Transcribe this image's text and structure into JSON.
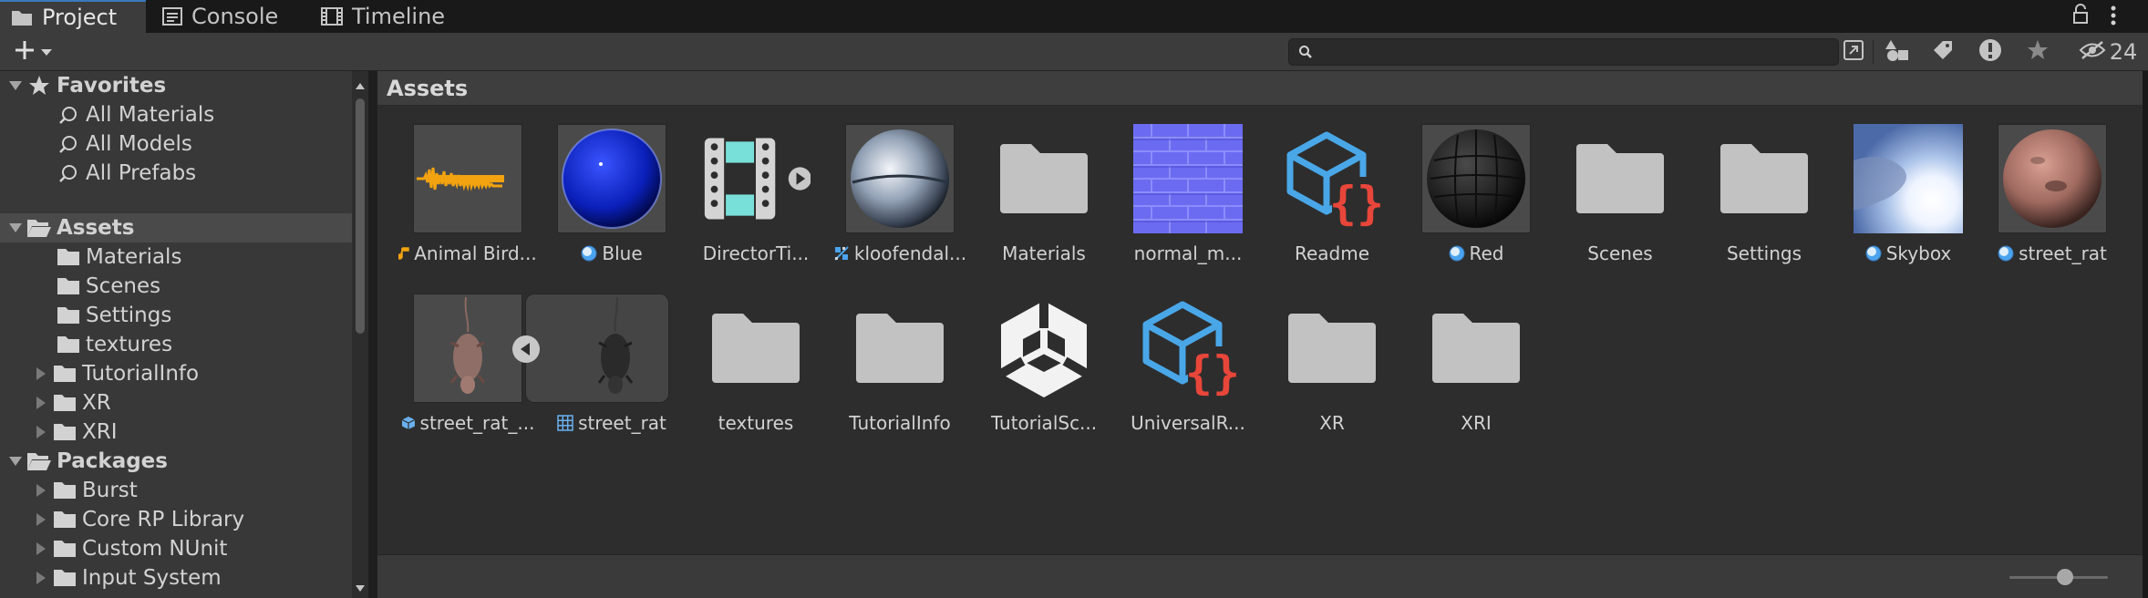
{
  "tabs": [
    {
      "label": "Project",
      "icon": "folder-icon",
      "active": true
    },
    {
      "label": "Console",
      "icon": "console-icon",
      "active": false
    },
    {
      "label": "Timeline",
      "icon": "film-icon",
      "active": false
    }
  ],
  "toolbar": {
    "create_icon": "plus-icon",
    "search_placeholder": "",
    "hidden_packages_count": "24"
  },
  "tree": {
    "favorites": {
      "label": "Favorites",
      "items": [
        "All Materials",
        "All Models",
        "All Prefabs"
      ]
    },
    "assets": {
      "label": "Assets",
      "items": [
        "Materials",
        "Scenes",
        "Settings",
        "textures",
        "TutorialInfo",
        "XR",
        "XRI"
      ]
    },
    "packages": {
      "label": "Packages",
      "items": [
        "Burst",
        "Core RP Library",
        "Custom NUnit",
        "Input System"
      ]
    }
  },
  "main": {
    "breadcrumb": "Assets",
    "items": [
      {
        "name": "Animal Bird...",
        "kind": "audio-clip",
        "badge": "audio-note-icon"
      },
      {
        "name": "Blue",
        "kind": "material",
        "badge": "material-icon",
        "color": "#0a1fb8"
      },
      {
        "name": "DirectorTi...",
        "kind": "timeline",
        "badge": ""
      },
      {
        "name": "kloofendal...",
        "kind": "texture",
        "badge": "texture-icon"
      },
      {
        "name": "Materials",
        "kind": "folder",
        "badge": ""
      },
      {
        "name": "normal_m...",
        "kind": "normal-map",
        "badge": "",
        "color": "#6b6bf2"
      },
      {
        "name": "Readme",
        "kind": "script",
        "badge": ""
      },
      {
        "name": "Red",
        "kind": "material",
        "badge": "material-icon",
        "color": "#222222"
      },
      {
        "name": "Scenes",
        "kind": "folder",
        "badge": ""
      },
      {
        "name": "Settings",
        "kind": "folder",
        "badge": ""
      },
      {
        "name": "Skybox",
        "kind": "skybox",
        "badge": "material-icon"
      },
      {
        "name": "street_rat",
        "kind": "material",
        "badge": "material-icon",
        "color": "#b57d72"
      },
      {
        "name": "street_rat_...",
        "kind": "model",
        "badge": "cube-icon"
      },
      {
        "name": "street_rat",
        "kind": "mesh",
        "badge": "grid-icon"
      },
      {
        "name": "textures",
        "kind": "folder",
        "badge": ""
      },
      {
        "name": "TutorialInfo",
        "kind": "folder",
        "badge": ""
      },
      {
        "name": "TutorialSc...",
        "kind": "unity-logo",
        "badge": ""
      },
      {
        "name": "UniversalR...",
        "kind": "script",
        "badge": ""
      },
      {
        "name": "XR",
        "kind": "folder",
        "badge": ""
      },
      {
        "name": "XRI",
        "kind": "folder",
        "badge": ""
      }
    ]
  },
  "colors": {
    "accent": "#3a79bb",
    "script_brace": "#e8463a",
    "script_cube": "#49a7e8",
    "audio_wave": "#f2a30f",
    "timeline_strip": "#78e0d8"
  }
}
